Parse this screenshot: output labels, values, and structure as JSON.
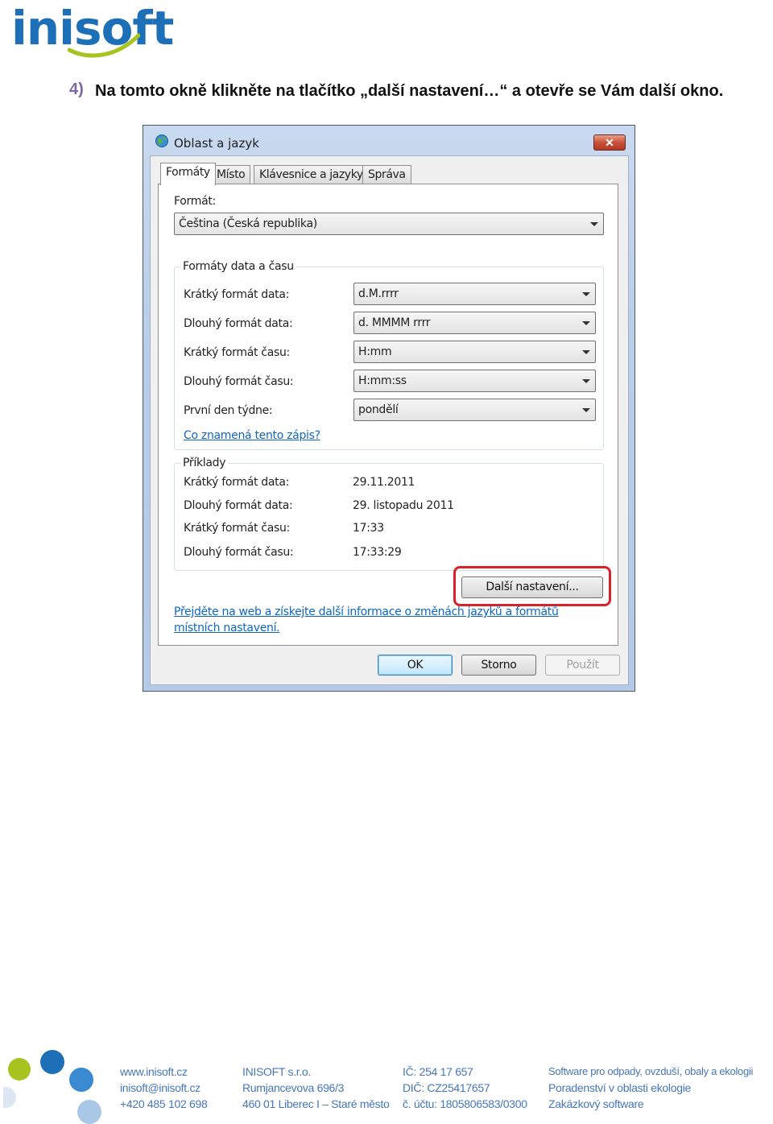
{
  "header": {
    "logo_text": "inisoft"
  },
  "instruction": {
    "number": "4)",
    "text": "Na tomto okně klikněte na tlačítko „další nastavení…“ a otevře se Vám další okno."
  },
  "dialog": {
    "title": "Oblast a jazyk",
    "close_label": "✕",
    "tabs": [
      "Formáty",
      "Místo",
      "Klávesnice a jazyky",
      "Správa"
    ],
    "active_tab": "Formáty",
    "format_label": "Formát:",
    "format_value": "Čeština (Česká republika)",
    "date_time_group": {
      "title": "Formáty data a času",
      "rows": [
        {
          "label": "Krátký formát data:",
          "value": "d.M.rrrr"
        },
        {
          "label": "Dlouhý formát data:",
          "value": "d. MMMM rrrr"
        },
        {
          "label": "Krátký formát času:",
          "value": "H:mm"
        },
        {
          "label": "Dlouhý formát času:",
          "value": "H:mm:ss"
        },
        {
          "label": "První den týdne:",
          "value": "pondělí"
        }
      ],
      "help_link": "Co znamená tento zápis?"
    },
    "examples_group": {
      "title": "Příklady",
      "rows": [
        {
          "label": "Krátký formát data:",
          "value": "29.11.2011"
        },
        {
          "label": "Dlouhý formát data:",
          "value": "29. listopadu 2011"
        },
        {
          "label": "Krátký formát času:",
          "value": "17:33"
        },
        {
          "label": "Dlouhý formát času:",
          "value": "17:33:29"
        }
      ]
    },
    "more_settings_label": "Další nastavení...",
    "web_link_line1": "Přejděte na web a získejte další informace o změnách jazyků a formátů",
    "web_link_line2": "místních nastavení.",
    "ok_label": "OK",
    "cancel_label": "Storno",
    "apply_label": "Použít"
  },
  "footer": {
    "col1": [
      "www.inisoft.cz",
      "inisoft@inisoft.cz",
      "+420 485 102 698"
    ],
    "col2": [
      "INISOFT s.r.o.",
      "Rumjancevova 696/3",
      "460 01 Liberec I – Staré město"
    ],
    "col3": [
      "IČ: 254 17 657",
      "DIČ: CZ25417657",
      "č. účtu: 1805806583/0300"
    ],
    "col4": [
      "Software pro odpady, ovzduší, obaly a ekologii",
      "Poradenství v oblasti ekologie",
      "Zakázkový software"
    ]
  },
  "colors": {
    "brand_blue": "#1d6fb7",
    "brand_green": "#a6c31f",
    "highlight_red": "#d9212a",
    "link_blue": "#0f66c2"
  }
}
